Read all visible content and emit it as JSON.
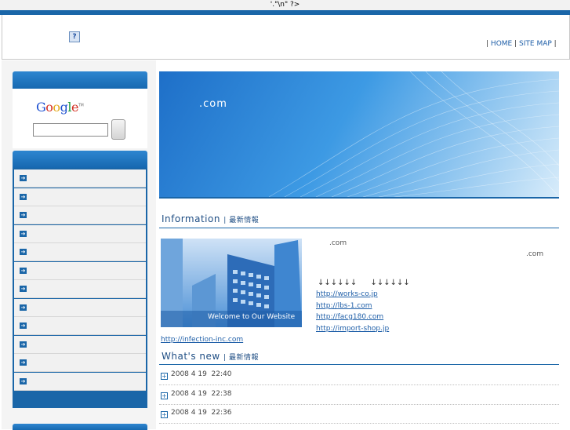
{
  "php_leak_text": "'.\"\\n\" ?>",
  "header": {
    "missing_image_glyph": "?",
    "nav": {
      "sep": "|",
      "home": "HOME",
      "sitemap": "SITE MAP"
    }
  },
  "search": {
    "logo_letters": [
      "G",
      "o",
      "o",
      "g",
      "l",
      "e"
    ],
    "logo_tm": "TM",
    "input_value": "",
    "button_label": ""
  },
  "menu": {
    "items": [
      {
        "label": ""
      },
      {
        "label": ""
      },
      {
        "label": ""
      },
      {
        "label": ""
      },
      {
        "label": ""
      },
      {
        "label": ""
      },
      {
        "label": ""
      },
      {
        "label": ""
      },
      {
        "label": ""
      },
      {
        "label": ""
      },
      {
        "label": ""
      },
      {
        "label": ""
      }
    ],
    "arrow_glyph": "➔"
  },
  "banner": {
    "title": ".com"
  },
  "information": {
    "title": "Information",
    "subtitle": "最新情報",
    "image_caption": "Welcome to Our Website",
    "text_1": ".com",
    "text_2": ".com",
    "arrows": "↓↓↓↓↓↓ ↓↓↓↓↓↓",
    "links": [
      "http://works-co.jp",
      "http://lbs-1.com",
      "http://facg180.com",
      "http://import-shop.jp"
    ],
    "link_bottom": "http://infection-inc.com"
  },
  "whats_new": {
    "title": "What's new",
    "subtitle": "最新情報",
    "items": [
      {
        "date": "2008 4 19  22:40"
      },
      {
        "date": "2008 4 19  22:38"
      },
      {
        "date": "2008 4 19  22:36"
      }
    ]
  },
  "colors": {
    "brand_blue": "#1a66a8",
    "link": "#1f5fa8"
  }
}
